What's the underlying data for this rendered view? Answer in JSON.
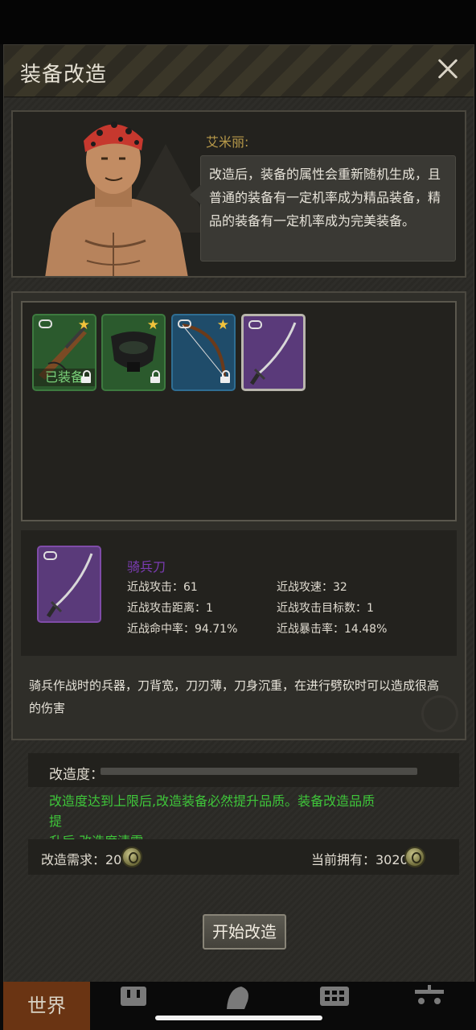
{
  "dialog": {
    "title": "装备改造"
  },
  "npc": {
    "name": "艾米丽:",
    "speech_lines": [
      "改造后，装备的属性会重新随机生成，且",
      "普通的装备有一定机率成为精品装备，精",
      "品的装备有一定机率成为完美装备。"
    ]
  },
  "inventory": {
    "slots": [
      {
        "item": "rifle",
        "rarity": "green",
        "star": true,
        "locked": true,
        "equipped": true
      },
      {
        "item": "gas-mask",
        "rarity": "green",
        "star": true,
        "locked": true,
        "equipped": false
      },
      {
        "item": "bow",
        "rarity": "blue",
        "star": true,
        "locked": true,
        "equipped": false
      },
      {
        "item": "sabre",
        "rarity": "purple",
        "star": false,
        "locked": false,
        "equipped": false,
        "selected": true
      }
    ],
    "equipped_label": "已装备"
  },
  "selected_item": {
    "name": "骑兵刀",
    "name_color": "#7b3cb3",
    "stats": {
      "melee_attack": "近战攻击：61",
      "melee_speed": "近战攻速：32",
      "melee_range": "近战攻击距离：1",
      "melee_targets": "近战攻击目标数：1",
      "melee_hit": "近战命中率：94.71%",
      "melee_crit": "近战暴击率：14.48%"
    },
    "description_line1": "骑兵作战时的兵器，刀背宽，刀刃薄，刀身沉重，在进行劈砍时可以造成很高",
    "description_line2": "的伤害"
  },
  "progress": {
    "label": "改造度：",
    "value_fraction": 0.0
  },
  "notice": {
    "line1": "改造度达到上限后,改造装备必然提升品质。装备改造品质提",
    "line2": "升后,改造度清零",
    "color": "#3fc63a"
  },
  "cost": {
    "required": "改造需求：20",
    "owned": "当前拥有：3020"
  },
  "start_button": "开始改造",
  "bottom_nav": {
    "world": "世界"
  }
}
